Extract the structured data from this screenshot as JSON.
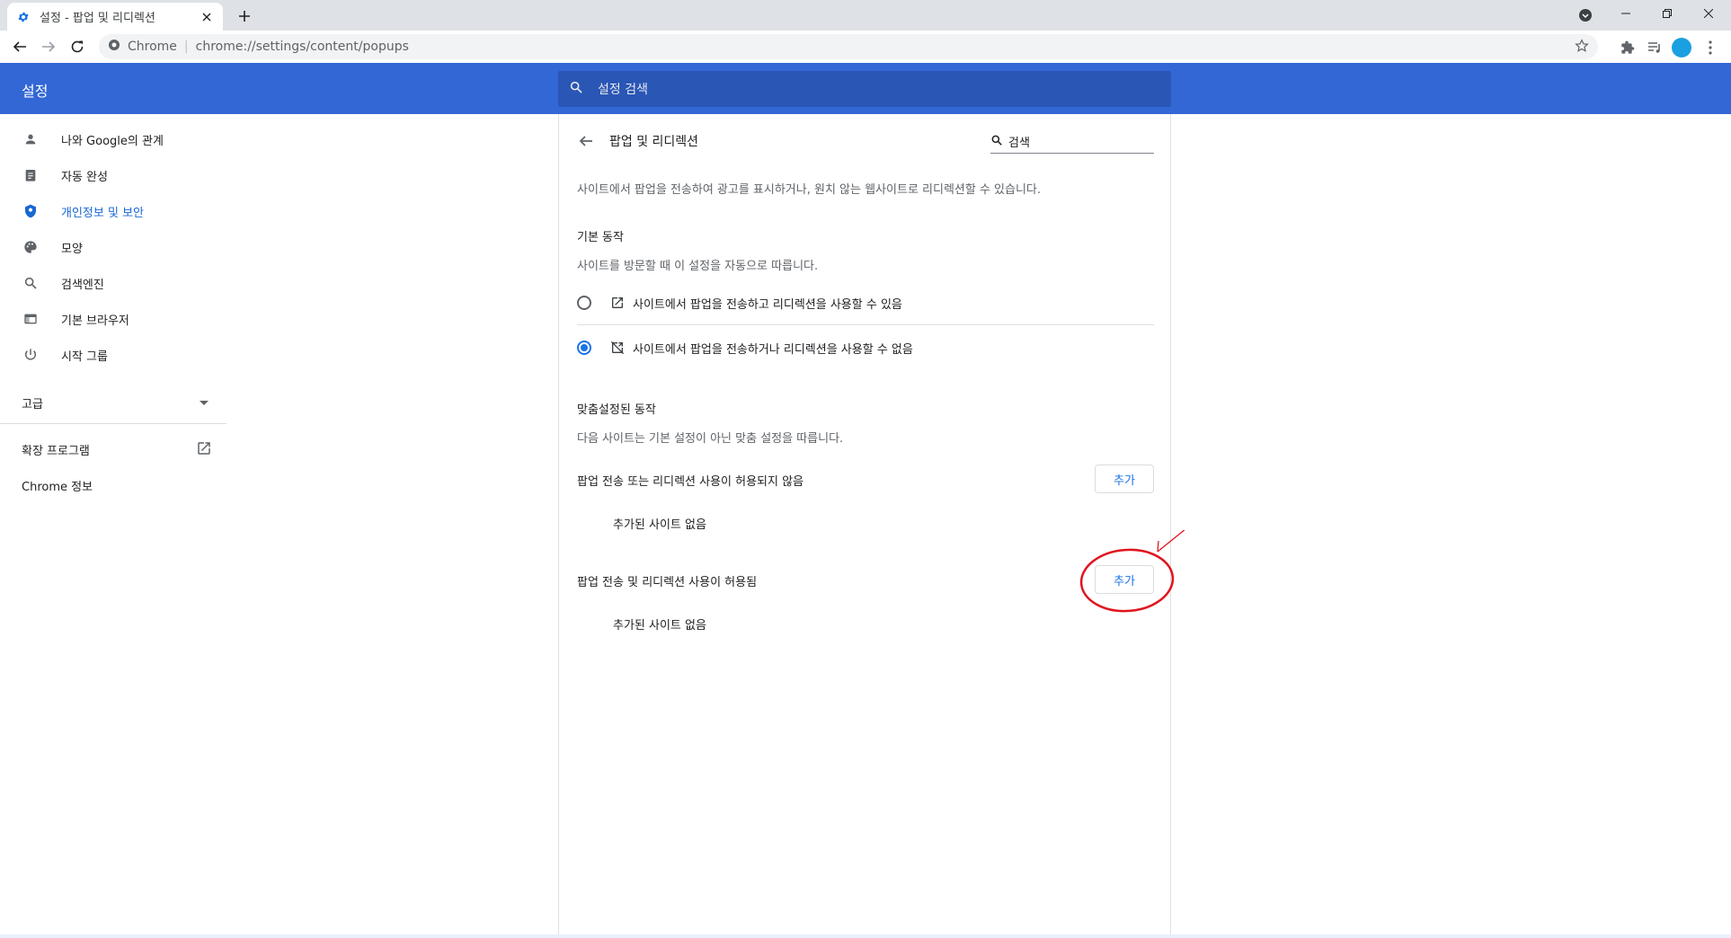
{
  "browser": {
    "tab_title": "설정 - 팝업 및 리디렉션",
    "omnibox_chrome": "Chrome",
    "omnibox_url": "chrome://settings/content/popups"
  },
  "header": {
    "title": "설정",
    "search_placeholder": "설정 검색"
  },
  "sidebar": {
    "items": [
      {
        "label": "나와 Google의 관계",
        "icon": "person-icon"
      },
      {
        "label": "자동 완성",
        "icon": "clipboard-icon"
      },
      {
        "label": "개인정보 및 보안",
        "icon": "shield-icon"
      },
      {
        "label": "모양",
        "icon": "palette-icon"
      },
      {
        "label": "검색엔진",
        "icon": "search-icon"
      },
      {
        "label": "기본 브라우저",
        "icon": "browser-icon"
      },
      {
        "label": "시작 그룹",
        "icon": "power-icon"
      }
    ],
    "advanced": "고급",
    "extensions": "확장 프로그램",
    "about": "Chrome 정보"
  },
  "main": {
    "page_title": "팝업 및 리디렉션",
    "search_value": "검색",
    "description": "사이트에서 팝업을 전송하여 광고를 표시하거나, 원치 않는 웹사이트로 리디렉션할 수 있습니다.",
    "default_title": "기본 동작",
    "default_sub": "사이트를 방문할 때 이 설정을 자동으로 따릅니다.",
    "option_allow": "사이트에서 팝업을 전송하고 리디렉션을 사용할 수 있음",
    "option_block": "사이트에서 팝업을 전송하거나 리디렉션을 사용할 수 없음",
    "custom_title": "맞춤설정된 동작",
    "custom_sub": "다음 사이트는 기본 설정이 아닌 맞춤 설정을 따릅니다.",
    "blocked_header": "팝업 전송 또는 리디렉션 사용이 허용되지 않음",
    "allowed_header": "팝업 전송 및 리디렉션 사용이 허용됨",
    "add_label": "추가",
    "empty_label": "추가된 사이트 없음"
  },
  "colors": {
    "accent": "#1a73e8",
    "header": "#3367d6",
    "annotation": "#e0141e"
  }
}
